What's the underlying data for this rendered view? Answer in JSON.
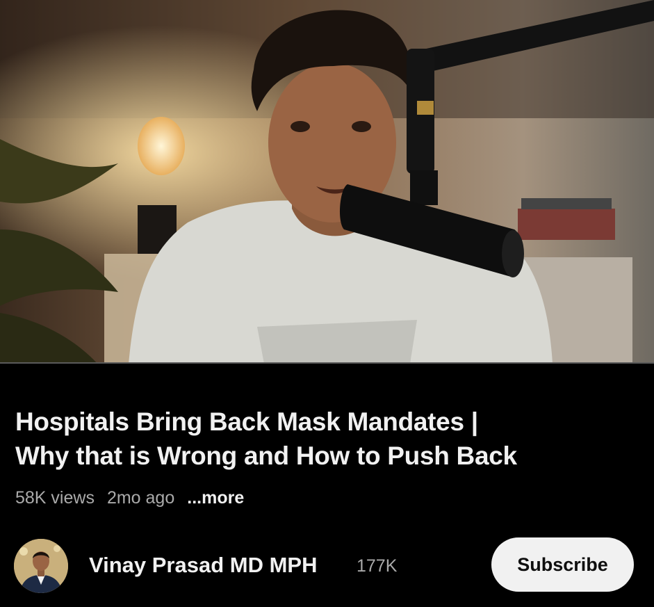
{
  "video": {
    "thumbnail_icon": "video-frame-man-with-microphone",
    "progress_fraction": 0.0
  },
  "title": {
    "line1": "Hospitals Bring Back Mask Mandates |",
    "line2": "Why that is Wrong and How to Push Back"
  },
  "meta": {
    "views": "58K views",
    "age": "2mo ago",
    "more_label": "...more"
  },
  "channel": {
    "avatar_icon": "channel-avatar",
    "name": "Vinay Prasad MD MPH",
    "subscriber_count": "177K",
    "subscribe_label": "Subscribe"
  },
  "colors": {
    "background": "#000000",
    "text_primary": "#f1f1f1",
    "text_secondary": "#aaaaaa",
    "button_bg": "#f1f1f1",
    "button_text": "#0f0f0f"
  }
}
